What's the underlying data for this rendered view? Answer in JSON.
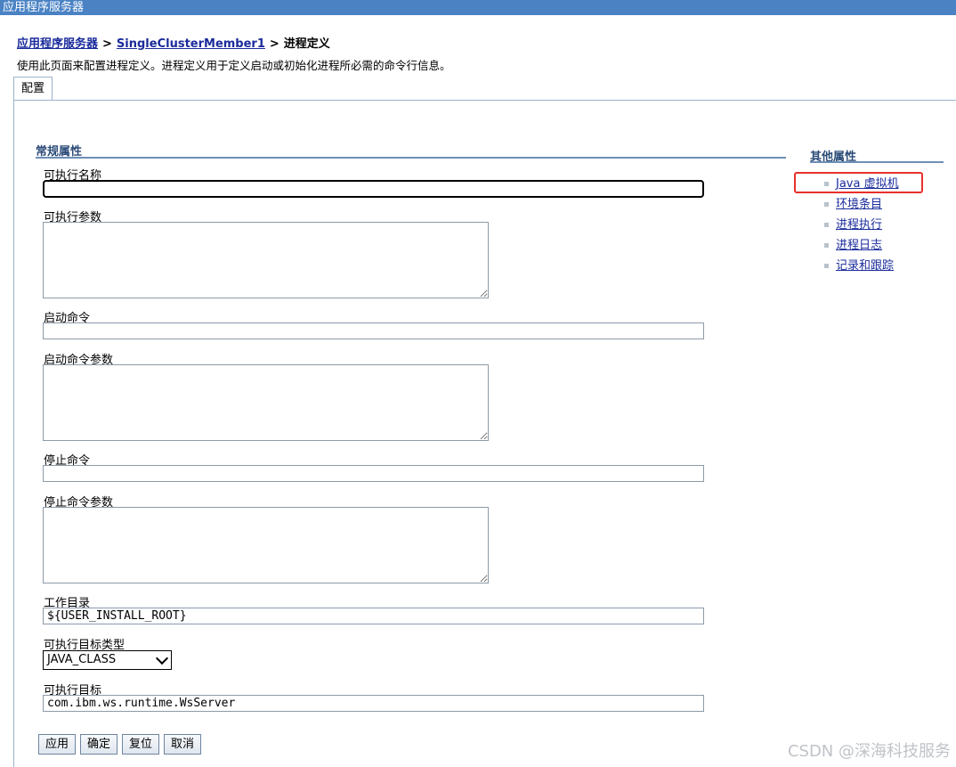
{
  "window": {
    "title": "应用程序服务器"
  },
  "breadcrumb": {
    "root": "应用程序服务器",
    "member": "SingleClusterMember1",
    "current": "进程定义",
    "separator": ">"
  },
  "description": "使用此页面来配置进程定义。进程定义用于定义启动或初始化进程所必需的命令行信息。",
  "tabs": [
    {
      "label": "配置"
    }
  ],
  "general": {
    "title": "常规属性",
    "fields": {
      "exec_name": {
        "label": "可执行名称",
        "value": ""
      },
      "exec_args": {
        "label": "可执行参数",
        "value": ""
      },
      "start_cmd": {
        "label": "启动命令",
        "value": ""
      },
      "start_args": {
        "label": "启动命令参数",
        "value": ""
      },
      "stop_cmd": {
        "label": "停止命令",
        "value": ""
      },
      "stop_args": {
        "label": "停止命令参数",
        "value": ""
      },
      "work_dir": {
        "label": "工作目录",
        "value": "${USER_INSTALL_ROOT}"
      },
      "target_type": {
        "label": "可执行目标类型",
        "value": "JAVA_CLASS"
      },
      "target": {
        "label": "可执行目标",
        "value": "com.ibm.ws.runtime.WsServer"
      }
    }
  },
  "additional": {
    "title": "其他属性",
    "items": [
      "Java 虚拟机",
      "环境条目",
      "进程执行",
      "进程日志",
      "记录和跟踪"
    ]
  },
  "buttons": {
    "apply": "应用",
    "ok": "确定",
    "reset": "复位",
    "cancel": "取消"
  },
  "watermark": "CSDN @深海科技服务",
  "colors": {
    "titlebar": "#4a82c4",
    "link": "#1a2b9c",
    "highlight": "#e8302c"
  }
}
